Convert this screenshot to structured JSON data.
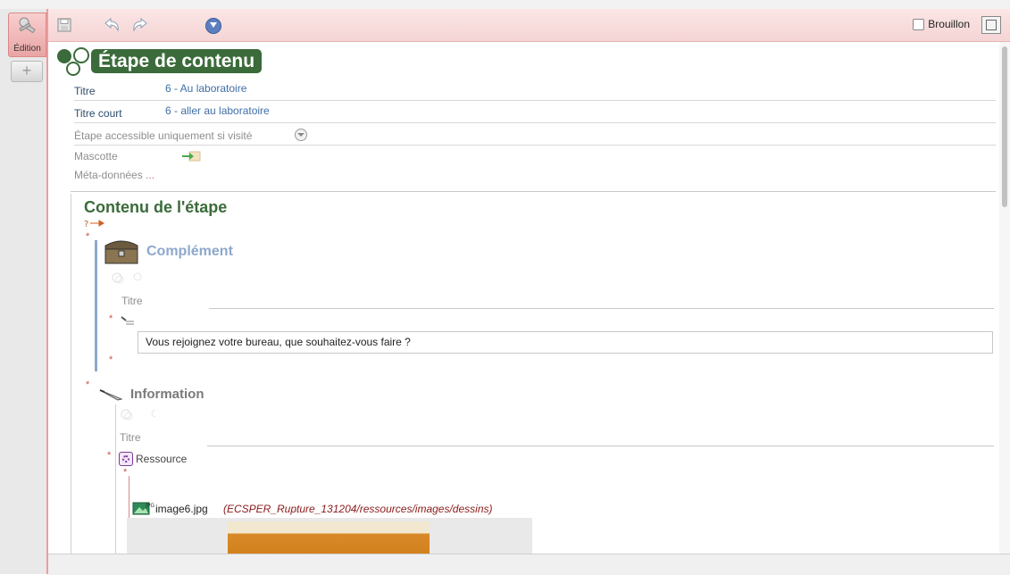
{
  "sidebar": {
    "edit_tab_label": "Édition",
    "add_tab_glyph": "+"
  },
  "toolbar": {
    "save_icon": "save-icon",
    "undo_icon": "undo-icon",
    "redo_icon": "redo-icon",
    "info_icon": "info-icon",
    "draft_label": "Brouillon"
  },
  "step": {
    "heading": "Étape de contenu",
    "fields": {
      "title_label": "Titre",
      "title_value": "6 - Au laboratoire",
      "short_title_label": "Titre court",
      "short_title_value": "6 - aller au laboratoire",
      "visited_label": "Étape accessible uniquement si visité",
      "mascot_label": "Mascotte",
      "metadata_label": "Méta-données",
      "metadata_dots": "..."
    }
  },
  "content": {
    "heading": "Contenu de l'étape",
    "complement": {
      "heading": "Complément",
      "title_label": "Titre",
      "text": "Vous rejoignez votre bureau, que souhaitez-vous faire ?"
    },
    "information": {
      "heading": "Information",
      "title_label": "Titre",
      "resource_label": "Ressource",
      "image_name": "image6.jpg",
      "image_path": "(ECSPER_Rupture_131204/ressources/images/dessins)"
    }
  },
  "colors": {
    "accent_pink": "#f29a9a",
    "title_green": "#3b6b3b",
    "link_blue": "#3f6fa8",
    "section_blue": "#8ea8cc"
  }
}
